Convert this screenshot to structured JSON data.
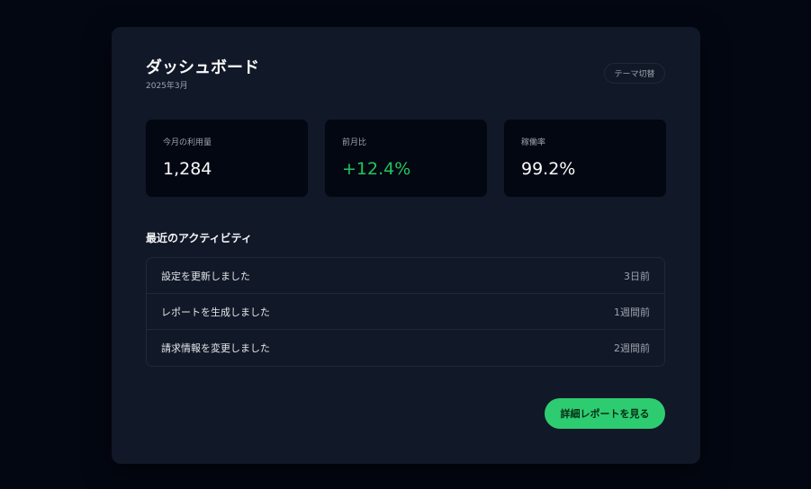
{
  "header": {
    "title": "ダッシュボード",
    "subtitle": "2025年3月",
    "theme_toggle_label": "テーマ切替"
  },
  "stats": [
    {
      "label": "今月の利用量",
      "value": "1,284"
    },
    {
      "label": "前月比",
      "value": "+12.4%"
    },
    {
      "label": "稼働率",
      "value": "99.2%"
    }
  ],
  "activity": {
    "title": "最近のアクティビティ",
    "items": [
      {
        "text": "設定を更新しました",
        "time": "3日前"
      },
      {
        "text": "レポートを生成しました",
        "time": "1週間前"
      },
      {
        "text": "請求情報を変更しました",
        "time": "2週間前"
      }
    ]
  },
  "cta": {
    "label": "詳細レポートを見る"
  },
  "colors": {
    "background": "#030712",
    "card": "#111827",
    "accent": "#2ecc71",
    "positive": "#22c55e"
  }
}
